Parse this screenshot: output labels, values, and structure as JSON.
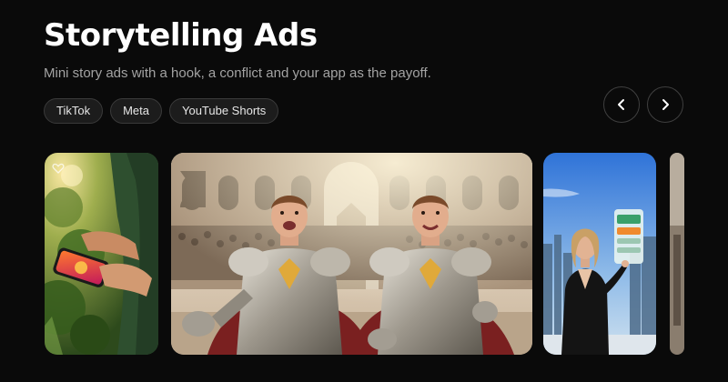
{
  "header": {
    "title": "Storytelling Ads",
    "subtitle": "Mini story ads with a hook, a conflict and your app as the payoff."
  },
  "tags": [
    {
      "label": "TikTok"
    },
    {
      "label": "Meta"
    },
    {
      "label": "YouTube Shorts"
    }
  ],
  "carousel": {
    "prev_icon": "chevron-left-icon",
    "next_icon": "chevron-right-icon",
    "cards": [
      {
        "name": "phone-app-ad",
        "icon": "heart-icon"
      },
      {
        "name": "knights-twins-ad"
      },
      {
        "name": "city-presenter-ad"
      },
      {
        "name": "partial-next-ad"
      }
    ]
  },
  "colors": {
    "background": "#0a0a0a",
    "text": "#ffffff",
    "muted_text": "#a3a3a3",
    "chip_border": "#3a3a3a"
  }
}
